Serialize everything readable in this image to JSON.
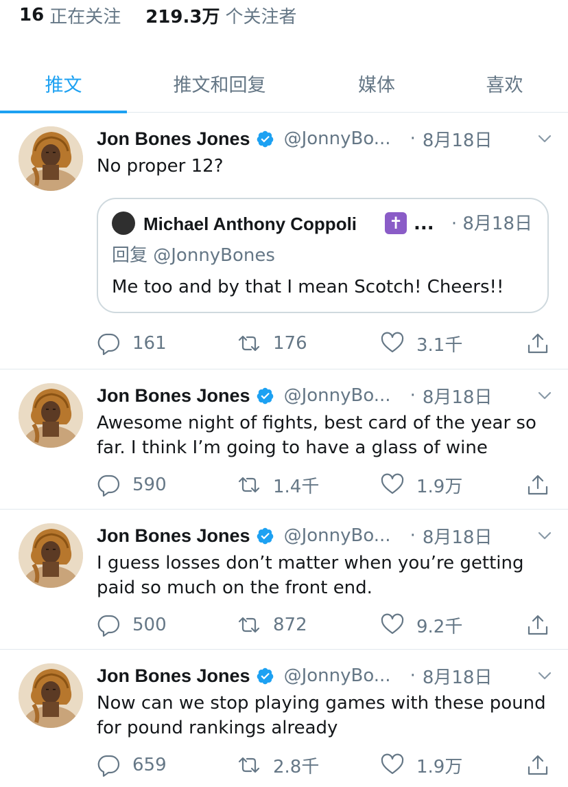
{
  "profile_stats": {
    "following_count": "16",
    "following_label": "正在关注",
    "followers_count": "219.3万",
    "followers_label": "个关注者"
  },
  "tabs": [
    {
      "label": "推文",
      "active": true
    },
    {
      "label": "推文和回复",
      "active": false
    },
    {
      "label": "媒体",
      "active": false
    },
    {
      "label": "喜欢",
      "active": false
    }
  ],
  "colors": {
    "accent": "#1da1f2",
    "secondary_text": "#657786",
    "primary_text": "#14171a"
  },
  "tweets": [
    {
      "name": "Jon Bones Jones",
      "handle": "@JonnyBo...",
      "dot": "·",
      "date": "8月18日",
      "text": "No proper 12?",
      "quote": {
        "name": "Michael Anthony Coppoli",
        "emoji": "✝",
        "ellipsis": "...",
        "dot": "·",
        "date": "8月18日",
        "reply_to": "回复 @JonnyBones",
        "text": "Me too and by that I mean Scotch! Cheers!!"
      },
      "replies": "161",
      "retweets": "176",
      "likes": "3.1千"
    },
    {
      "name": "Jon Bones Jones",
      "handle": "@JonnyBo...",
      "dot": "·",
      "date": "8月18日",
      "text": "Awesome night of fights, best card of the year so far. I think I’m going to have a glass of wine",
      "replies": "590",
      "retweets": "1.4千",
      "likes": "1.9万"
    },
    {
      "name": "Jon Bones Jones",
      "handle": "@JonnyBo...",
      "dot": "·",
      "date": "8月18日",
      "text": "I guess losses don’t matter when you’re getting paid so much on the front end.",
      "replies": "500",
      "retweets": "872",
      "likes": "9.2千"
    },
    {
      "name": "Jon Bones Jones",
      "handle": "@JonnyBo...",
      "dot": "·",
      "date": "8月18日",
      "text": "Now can we stop playing games with these pound for pound rankings already",
      "replies": "659",
      "retweets": "2.8千",
      "likes": "1.9万"
    }
  ]
}
